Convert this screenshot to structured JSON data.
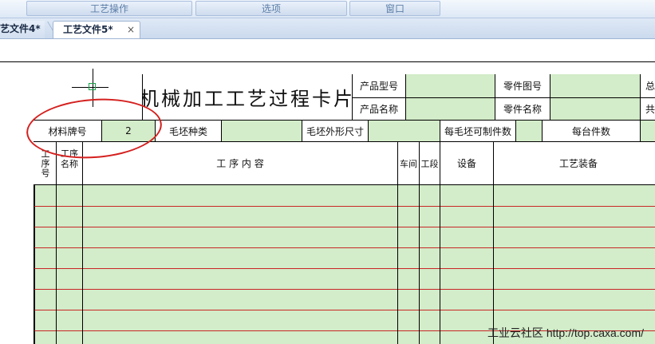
{
  "menubar": {
    "items": [
      "工艺操作",
      "选项",
      "窗口"
    ]
  },
  "tabs": [
    {
      "label": "艺文件4*",
      "active": false
    },
    {
      "label": "工艺文件5*",
      "active": true,
      "close": "×"
    }
  ],
  "card": {
    "title": "机械加工工艺过程卡片",
    "header": {
      "product_model_label": "产品型号",
      "product_name_label": "产品名称",
      "part_drawing_label": "零件图号",
      "part_name_label": "零件名称",
      "right_cut_1": "总",
      "right_cut_2": "共"
    },
    "material_row": {
      "material_label": "材料牌号",
      "material_value": "2",
      "blank_type_label": "毛坯种类",
      "blank_size_label": "毛坯外形尺寸",
      "parts_per_blank_label": "每毛坯可制件数",
      "parts_per_unit_label": "每台件数"
    },
    "columns": {
      "op_no": "工序号",
      "op_name": "工序名称",
      "op_content": "工 序 内 容",
      "workshop": "车间",
      "section": "工段",
      "equipment": "设备",
      "tooling": "工艺装备"
    }
  },
  "watermark": "工业云社区 http://top.caxa.com/",
  "colors": {
    "cell_fill": "#d3ecc9",
    "grid_line": "#c82828",
    "annotation": "#d4201e"
  }
}
